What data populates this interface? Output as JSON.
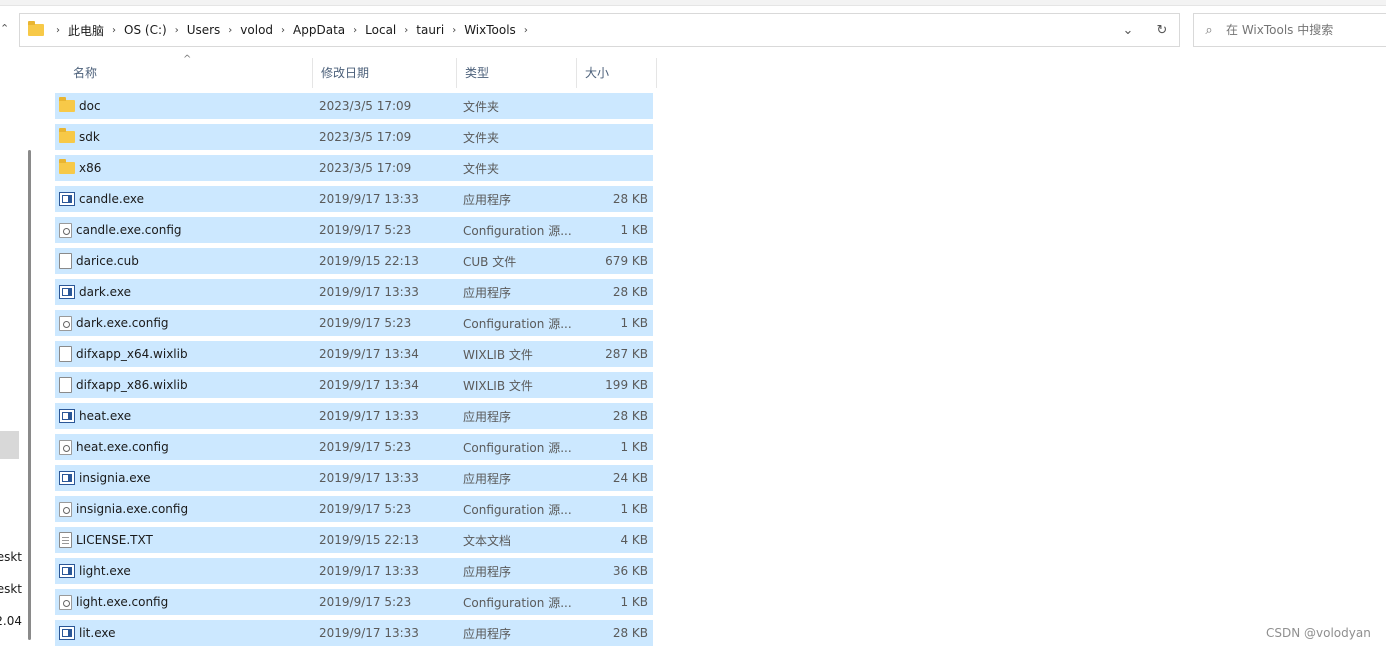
{
  "address": {
    "breadcrumb": [
      "此电脑",
      "OS (C:)",
      "Users",
      "volod",
      "AppData",
      "Local",
      "tauri",
      "WixTools"
    ],
    "dropdown_icon": "chevron-down-icon",
    "refresh_icon": "refresh-icon"
  },
  "search": {
    "placeholder": "在 WixTools 中搜索"
  },
  "nav_labels": [
    "eskt",
    "eskt",
    "2.04"
  ],
  "columns": {
    "name": "名称",
    "date": "修改日期",
    "type": "类型",
    "size": "大小"
  },
  "files": [
    {
      "name": "doc",
      "date": "2023/3/5 17:09",
      "type": "文件夹",
      "size": "",
      "icon": "folder"
    },
    {
      "name": "sdk",
      "date": "2023/3/5 17:09",
      "type": "文件夹",
      "size": "",
      "icon": "folder"
    },
    {
      "name": "x86",
      "date": "2023/3/5 17:09",
      "type": "文件夹",
      "size": "",
      "icon": "folder"
    },
    {
      "name": "candle.exe",
      "date": "2019/9/17 13:33",
      "type": "应用程序",
      "size": "28 KB",
      "icon": "app"
    },
    {
      "name": "candle.exe.config",
      "date": "2019/9/17 5:23",
      "type": "Configuration 源...",
      "size": "1 KB",
      "icon": "config"
    },
    {
      "name": "darice.cub",
      "date": "2019/9/15 22:13",
      "type": "CUB 文件",
      "size": "679 KB",
      "icon": "file"
    },
    {
      "name": "dark.exe",
      "date": "2019/9/17 13:33",
      "type": "应用程序",
      "size": "28 KB",
      "icon": "app"
    },
    {
      "name": "dark.exe.config",
      "date": "2019/9/17 5:23",
      "type": "Configuration 源...",
      "size": "1 KB",
      "icon": "config"
    },
    {
      "name": "difxapp_x64.wixlib",
      "date": "2019/9/17 13:34",
      "type": "WIXLIB 文件",
      "size": "287 KB",
      "icon": "file"
    },
    {
      "name": "difxapp_x86.wixlib",
      "date": "2019/9/17 13:34",
      "type": "WIXLIB 文件",
      "size": "199 KB",
      "icon": "file"
    },
    {
      "name": "heat.exe",
      "date": "2019/9/17 13:33",
      "type": "应用程序",
      "size": "28 KB",
      "icon": "app"
    },
    {
      "name": "heat.exe.config",
      "date": "2019/9/17 5:23",
      "type": "Configuration 源...",
      "size": "1 KB",
      "icon": "config"
    },
    {
      "name": "insignia.exe",
      "date": "2019/9/17 13:33",
      "type": "应用程序",
      "size": "24 KB",
      "icon": "app"
    },
    {
      "name": "insignia.exe.config",
      "date": "2019/9/17 5:23",
      "type": "Configuration 源...",
      "size": "1 KB",
      "icon": "config"
    },
    {
      "name": "LICENSE.TXT",
      "date": "2019/9/15 22:13",
      "type": "文本文档",
      "size": "4 KB",
      "icon": "text"
    },
    {
      "name": "light.exe",
      "date": "2019/9/17 13:33",
      "type": "应用程序",
      "size": "36 KB",
      "icon": "app"
    },
    {
      "name": "light.exe.config",
      "date": "2019/9/17 5:23",
      "type": "Configuration 源...",
      "size": "1 KB",
      "icon": "config"
    },
    {
      "name": "lit.exe",
      "date": "2019/9/17 13:33",
      "type": "应用程序",
      "size": "28 KB",
      "icon": "app"
    }
  ],
  "watermark": "CSDN @volodyan"
}
